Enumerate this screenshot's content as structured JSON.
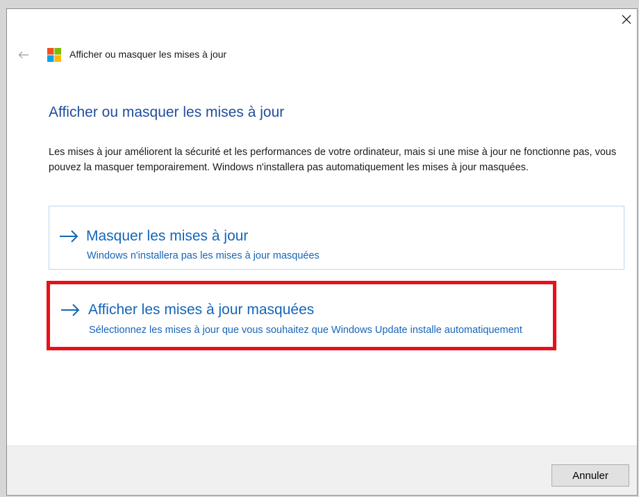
{
  "window": {
    "title": "Afficher ou masquer les mises à jour"
  },
  "page": {
    "heading": "Afficher ou masquer les mises à jour",
    "description": "Les mises à jour améliorent la sécurité et les performances de votre ordinateur, mais si une mise à jour ne fonctionne pas, vous pouvez la masquer temporairement. Windows n'installera pas automatiquement les mises à jour masquées."
  },
  "options": [
    {
      "title": "Masquer les mises à jour",
      "subtitle": "Windows n'installera pas les mises à jour masquées"
    },
    {
      "title": "Afficher les mises à jour masquées",
      "subtitle": "Sélectionnez les mises à jour que vous souhaitez que Windows Update installe automatiquement"
    }
  ],
  "footer": {
    "cancel_label": "Annuler"
  },
  "icons": {
    "close": "close-icon",
    "back": "back-arrow-icon",
    "logo": "windows-logo-icon",
    "option_arrow": "arrow-right-icon"
  },
  "colors": {
    "heading": "#1e4e9c",
    "link": "#1565b8",
    "highlight_border": "#e8101a",
    "option_border": "#b8d8f0",
    "footer_bg": "#f0f0f0"
  }
}
